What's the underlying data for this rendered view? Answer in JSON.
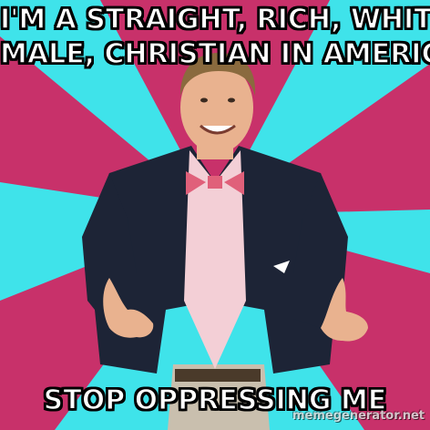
{
  "meme": {
    "top_line_1": "I'M A STRAIGHT, RICH, WHITE,",
    "top_line_2": "MALE, CHRISTIAN IN AMERICA",
    "bottom_text": "STOP OPPRESSING ME",
    "watermark": "memegenerator.net"
  },
  "colors": {
    "cyan": "#3fe3ea",
    "magenta": "#c8316a",
    "jacket": "#1d2436",
    "shirt": "#f3cfd6",
    "skin": "#e9b28f",
    "hair": "#8a6a3e",
    "bowtie": "#e0607a",
    "pants": "#c9bfae",
    "text": "#ffffff",
    "outline": "#000000"
  }
}
